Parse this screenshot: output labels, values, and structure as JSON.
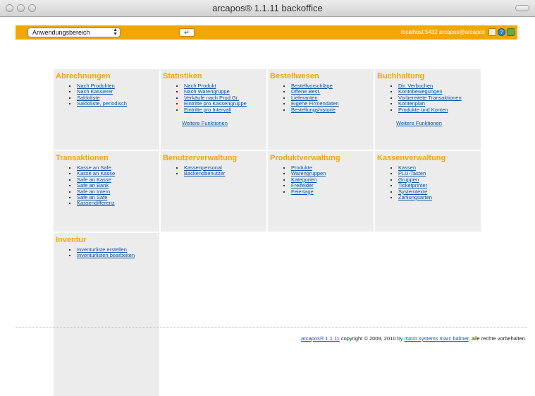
{
  "window": {
    "title": "arcapos® 1.1.11 backoffice"
  },
  "toolbar": {
    "select_value": "Anwendungsbereich",
    "enter_label": "↵",
    "host_text": "localhost:5432 arcapos@arcapos",
    "help_label": "?"
  },
  "sections": [
    {
      "title": "Abrechnungen",
      "items": [
        "Nach Produkten",
        "Nach Kassierer",
        "Saldoliste",
        "Saldoliste, periodisch"
      ]
    },
    {
      "title": "Statistiken",
      "items": [
        "Nach Produkt",
        "Nach Warengruppe",
        "Verkäufe nach Prod.Gr.",
        "Eintritte pro Kassengruppe",
        "Eintritte pro Intervall"
      ],
      "more": "Weitere Funktionen"
    },
    {
      "title": "Bestellwesen",
      "items": [
        "Bestellvorschläge",
        "Offene Best.",
        "Lieferanten",
        "Eigene Firmendaten",
        "Bestellungshistorie"
      ]
    },
    {
      "title": "Buchhaltung",
      "items": [
        "Dir. Verbuchen",
        "Kontobewegungen",
        "Vorbereitete Transaktionen",
        "Kontenplan",
        "Produkte und Konten"
      ],
      "more": "Weitere Funktionen"
    },
    {
      "title": "Transaktionen",
      "items": [
        "Kasse an Safe",
        "Kasse an Kasse",
        "Safe an Kasse",
        "Safe an Bank",
        "Safe an Intern",
        "Safe an Safe",
        "Kassendifferenz"
      ]
    },
    {
      "title": "Benutzerverwaltung",
      "items": [
        "Kassenpersonal",
        "Backendbenutzer"
      ]
    },
    {
      "title": "Produktverwaltung",
      "items": [
        "Produkte",
        "Warengruppen",
        "Kategorien",
        "Freifelder",
        "Feiertage"
      ]
    },
    {
      "title": "Kassenverwaltung",
      "items": [
        "Kassen",
        "PLU-Tasten",
        "Gruppen",
        "Ticketprinter",
        "Systemtexte",
        "Zahlungsarten"
      ]
    },
    {
      "title": "Inventur",
      "items": [
        "Inventurliste erstellen",
        "Inventurlisten bearbeiten"
      ]
    }
  ],
  "footer": {
    "product_link": "arcapos® 1.1.11",
    "copyright_text": " copyright © 2009, 2010 by ",
    "company_link": "micro systems marc balmer",
    "rights_text": ", alle rechte vorbehalten."
  }
}
